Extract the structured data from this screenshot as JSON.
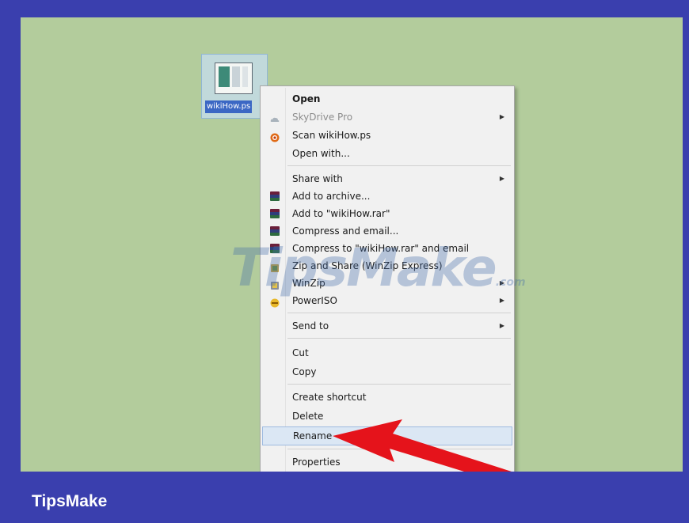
{
  "file": {
    "name": "wikiHow.ps"
  },
  "menu": {
    "items": [
      {
        "label": "Open",
        "icon": "none",
        "style": "bold"
      },
      {
        "label": "SkyDrive Pro",
        "icon": "cloud-icon",
        "style": "dim",
        "submenu": true
      },
      {
        "label": "Scan wikiHow.ps",
        "icon": "antivirus-icon"
      },
      {
        "label": "Open with..."
      },
      {
        "label": "Share with",
        "submenu": true
      },
      {
        "label": "Add to archive...",
        "icon": "rar-icon"
      },
      {
        "label": "Add to \"wikiHow.rar\"",
        "icon": "rar-icon"
      },
      {
        "label": "Compress and email...",
        "icon": "rar-icon"
      },
      {
        "label": "Compress to \"wikiHow.rar\" and email",
        "icon": "rar-icon"
      },
      {
        "label": "Zip and Share (WinZip Express)",
        "icon": "winzip-icon"
      },
      {
        "label": "WinZip",
        "icon": "winzip-icon",
        "submenu": true
      },
      {
        "label": "PowerISO",
        "icon": "poweriso-icon",
        "submenu": true
      },
      {
        "label": "Send to",
        "submenu": true
      },
      {
        "label": "Cut"
      },
      {
        "label": "Copy"
      },
      {
        "label": "Create shortcut"
      },
      {
        "label": "Delete"
      },
      {
        "label": "Rename",
        "highlighted": true
      },
      {
        "label": "Properties"
      }
    ],
    "submenu_glyph": "▶"
  },
  "watermark": {
    "text": "TipsMake",
    "suffix": ".com"
  },
  "footer": {
    "brand": "TipsMake"
  },
  "colors": {
    "frame": "#3a3fae",
    "desktop": "#b3cc9c",
    "menu_bg": "#f1f1f1",
    "highlight": "#dbe7f4",
    "arrow": "#e5131b"
  }
}
